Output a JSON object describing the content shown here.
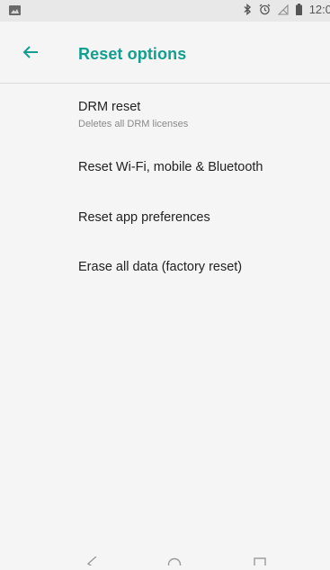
{
  "status_bar": {
    "time": "12:0",
    "icons": [
      "image-icon",
      "bluetooth-icon",
      "alarm-icon",
      "no-signal-icon",
      "battery-icon"
    ]
  },
  "toolbar": {
    "title": "Reset options",
    "back_icon": "arrow-left-icon"
  },
  "items": [
    {
      "title": "DRM reset",
      "subtitle": "Deletes all DRM licenses"
    },
    {
      "title": "Reset Wi-Fi, mobile & Bluetooth"
    },
    {
      "title": "Reset app preferences"
    },
    {
      "title": "Erase all data (factory reset)"
    }
  ],
  "nav_bar": {
    "icons": [
      "back-triangle-icon",
      "home-circle-icon",
      "recents-square-icon"
    ]
  },
  "colors": {
    "accent": "#129f8f",
    "background": "#f5f5f5",
    "status_bar": "#e8e8e8"
  }
}
